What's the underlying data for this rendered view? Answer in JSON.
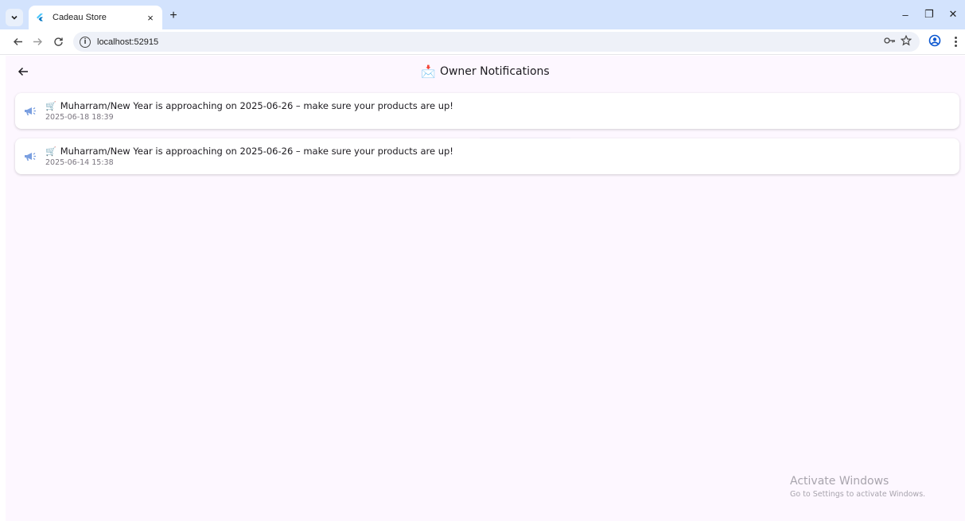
{
  "browser": {
    "tab_title": "Cadeau Store",
    "tab_close_glyph": "×",
    "new_tab_glyph": "+",
    "url": "localhost:52915",
    "window_controls": [
      "–",
      "❐",
      "✕"
    ],
    "icons": {
      "tab_menu": "chevron-down-icon",
      "favicon": "flutter-icon",
      "back": "arrow-left-icon",
      "forward": "arrow-right-icon",
      "reload": "reload-icon",
      "site_info": "info-icon",
      "password": "key-icon",
      "bookmark": "star-icon",
      "profile": "profile-icon",
      "menu": "kebab-icon"
    }
  },
  "app": {
    "title_emoji": "📩",
    "title": "Owner Notifications",
    "back_icon": "arrow-left-icon",
    "accent": "#7a9fe0",
    "background": "#fdf7ff",
    "notifications": [
      {
        "icon": "megaphone-icon",
        "cart": "🛒",
        "message": "Muharram/New Year is approaching on 2025-06-26 – make sure your products are up!",
        "timestamp": "2025-06-18 18:39"
      },
      {
        "icon": "megaphone-icon",
        "cart": "🛒",
        "message": "Muharram/New Year is approaching on 2025-06-26 – make sure your products are up!",
        "timestamp": "2025-06-14 15:38"
      }
    ]
  },
  "watermark": {
    "title": "Activate Windows",
    "subtitle": "Go to Settings to activate Windows."
  }
}
